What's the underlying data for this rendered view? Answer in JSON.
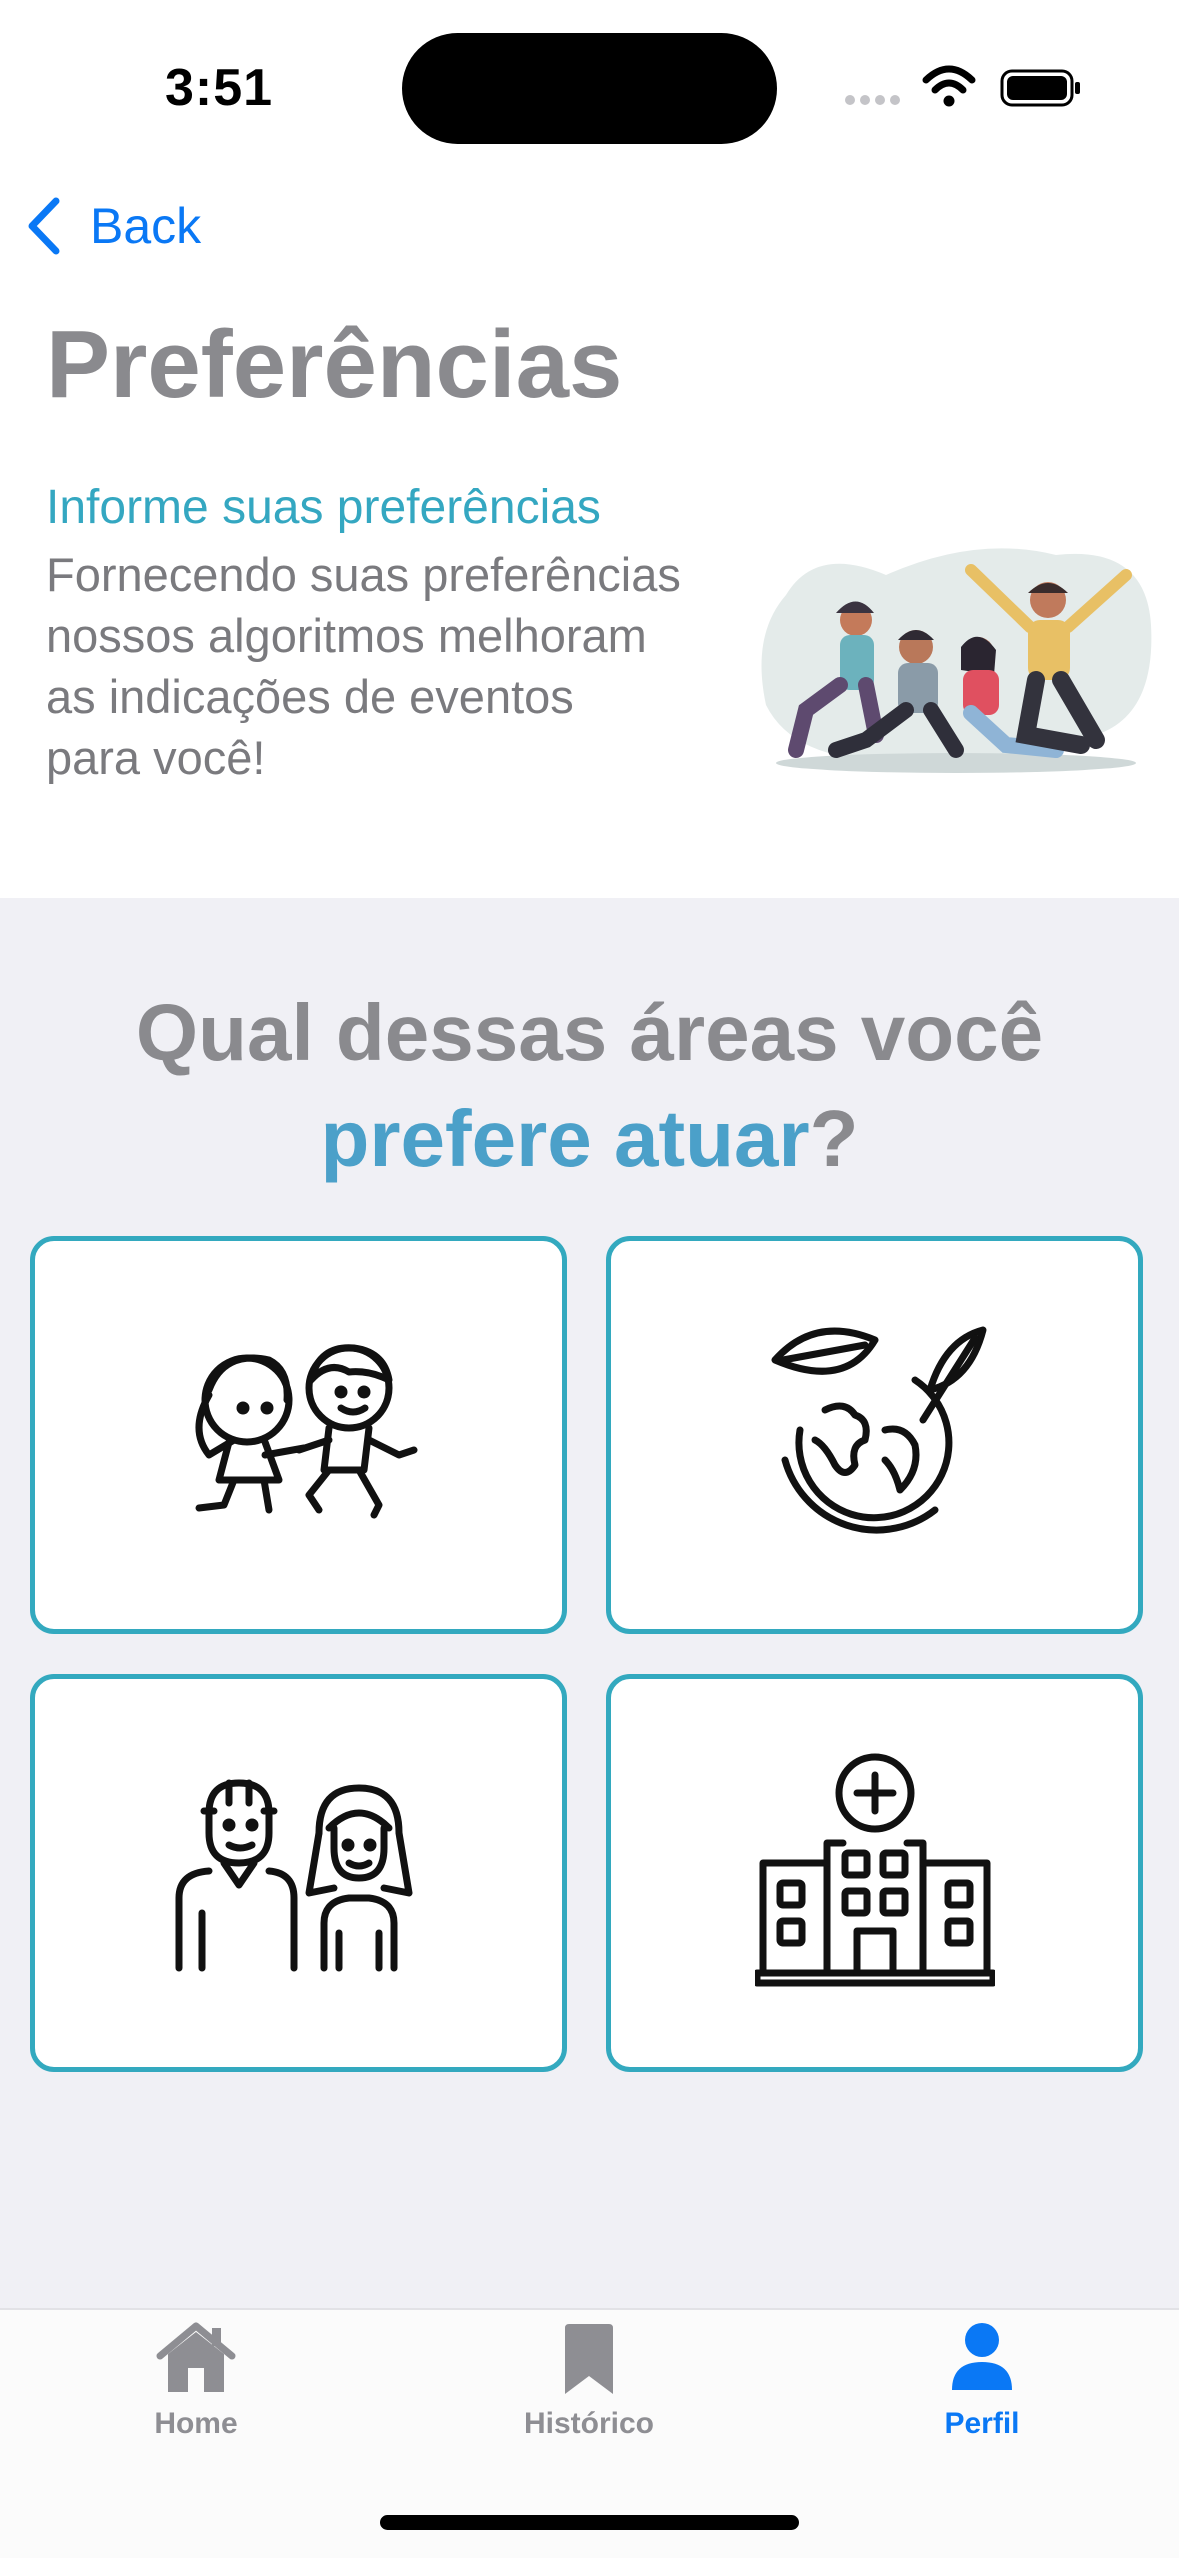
{
  "status_bar": {
    "time": "3:51"
  },
  "nav": {
    "back_label": "Back"
  },
  "header": {
    "title": "Preferências",
    "subtitle": "Informe suas preferências",
    "description": [
      "Fornecendo suas preferências",
      "nossos algoritmos melhoram",
      "as indicações de eventos",
      "para você!"
    ]
  },
  "question": {
    "part1": "Qual dessas áreas você",
    "accent": "prefere atuar",
    "suffix": "?"
  },
  "areas": [
    {
      "icon": "children-icon"
    },
    {
      "icon": "earth-leaves-icon"
    },
    {
      "icon": "elderly-couple-icon"
    },
    {
      "icon": "hospital-icon"
    }
  ],
  "tabbar": {
    "items": [
      {
        "label": "Home",
        "icon": "home-icon",
        "active": false
      },
      {
        "label": "Histórico",
        "icon": "bookmark-icon",
        "active": false
      },
      {
        "label": "Perfil",
        "icon": "person-icon",
        "active": true
      }
    ]
  },
  "colors": {
    "accent_blue": "#0a78f5",
    "teal": "#33a9bf",
    "gray_text": "#8a8a8e",
    "section_bg": "#f0f0f5"
  }
}
